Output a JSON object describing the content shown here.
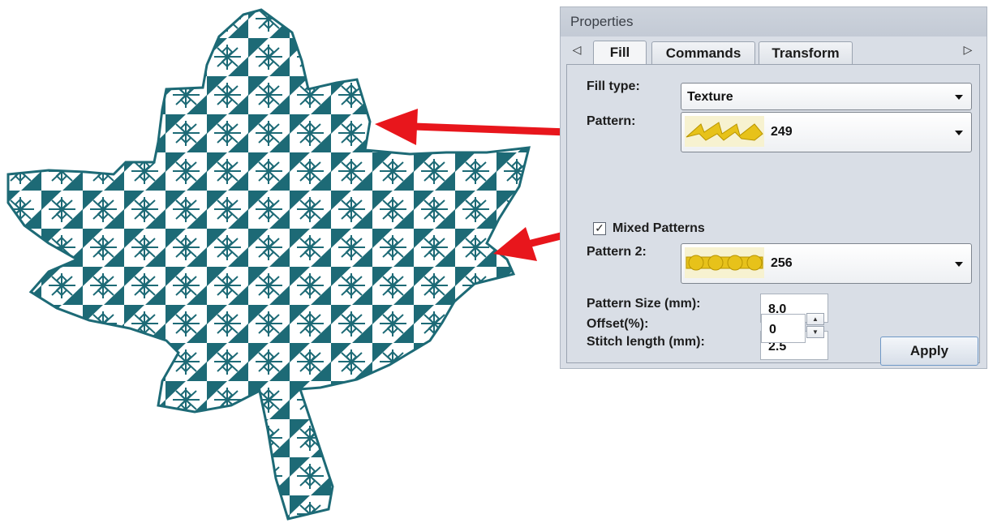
{
  "panel": {
    "title": "Properties",
    "tabs": [
      {
        "label": "Fill",
        "active": true
      },
      {
        "label": "Commands",
        "active": false
      },
      {
        "label": "Transform",
        "active": false
      }
    ],
    "tab_scroll_left_icon": "triangle-left-icon",
    "tab_scroll_right_icon": "triangle-right-icon"
  },
  "fill": {
    "fill_type_label": "Fill type:",
    "fill_type_value": "Texture",
    "pattern_label": "Pattern:",
    "pattern_value": "249",
    "mixed_patterns_label": "Mixed Patterns",
    "mixed_patterns_checked": true,
    "pattern2_label": "Pattern 2:",
    "pattern2_value": "256",
    "pattern_size_label": "Pattern Size (mm):",
    "pattern_size_value": "8.0",
    "stitch_length_label": "Stitch length (mm):",
    "stitch_length_value": "2.5",
    "offset_label": "Offset(%):",
    "offset_value": "0",
    "apply_label": "Apply"
  },
  "colors": {
    "leaf_fill": "#1d6a76",
    "arrow": "#e8161c",
    "pattern_gold": "#e7c21a"
  }
}
